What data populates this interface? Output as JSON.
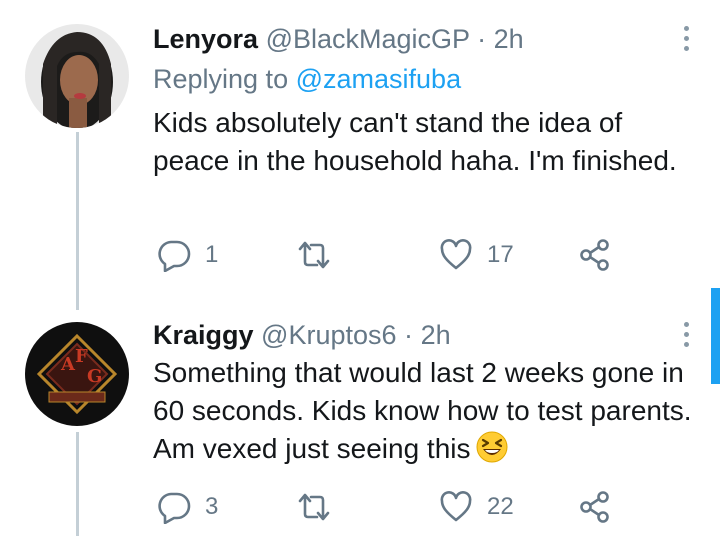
{
  "tweets": [
    {
      "display_name": "Lenyora",
      "handle": "@BlackMagicGP",
      "separator": "·",
      "time": "2h",
      "replying_prefix": "Replying to",
      "replying_to": "@zamasifuba",
      "text": "Kids absolutely can't stand the idea of peace in the household haha. I'm finished.",
      "actions": {
        "replies": "1",
        "retweets": "",
        "likes": "17"
      }
    },
    {
      "display_name": "Kraiggy",
      "handle": "@Kruptos6",
      "separator": "·",
      "time": "2h",
      "text": "Something that would last 2 weeks gone in 60 seconds. Kids know how to test parents. Am vexed just seeing this",
      "emoji": "grinning-squinting-face",
      "avatar_logo_text": "AFG",
      "actions": {
        "replies": "3",
        "retweets": "",
        "likes": "22"
      }
    }
  ],
  "icons": {
    "reply": "speech-bubble",
    "retweet": "retweet-arrows",
    "like": "heart-outline",
    "share": "share-nodes",
    "more": "vertical-ellipsis"
  },
  "colors": {
    "text": "#14171a",
    "secondary": "#657786",
    "accent": "#1da1f2",
    "thread_line": "#c4cfd6"
  }
}
